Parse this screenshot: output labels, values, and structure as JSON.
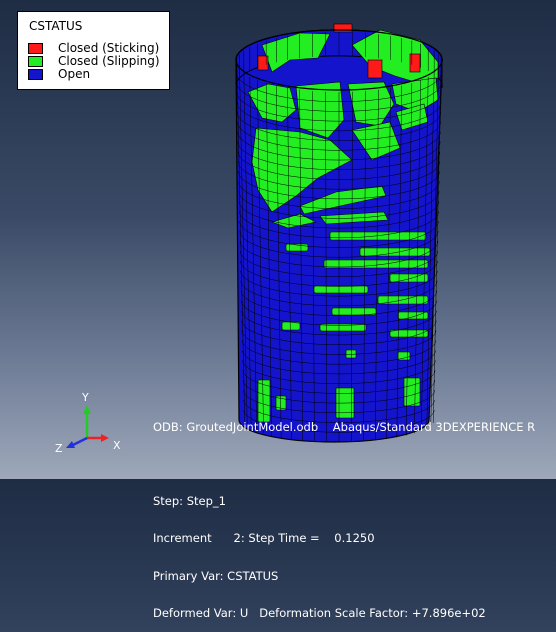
{
  "legend": {
    "title": "CSTATUS",
    "items": [
      {
        "label": "Closed (Sticking)",
        "color": "#ff1a1a"
      },
      {
        "label": "Closed (Slipping)",
        "color": "#22ee22"
      },
      {
        "label": "Open",
        "color": "#1414cc"
      }
    ]
  },
  "triad": {
    "x": "X",
    "y": "Y",
    "z": "Z"
  },
  "info": {
    "odb": "ODB: GroutedJointModel.odb    Abaqus/Standard 3DEXPERIENCE R",
    "step": "Step: Step_1",
    "increment": "Increment      2: Step Time =    0.1250",
    "primary_var": "Primary Var: CSTATUS",
    "deformed_var": "Deformed Var: U   Deformation Scale Factor: +7.896e+02"
  },
  "colors": {
    "open": "#1414cc",
    "slipping": "#22ee22",
    "sticking": "#ff1a1a",
    "mesh": "#000000",
    "background_top": "#1e2c44",
    "background_bottom": "#9ea8ba"
  }
}
